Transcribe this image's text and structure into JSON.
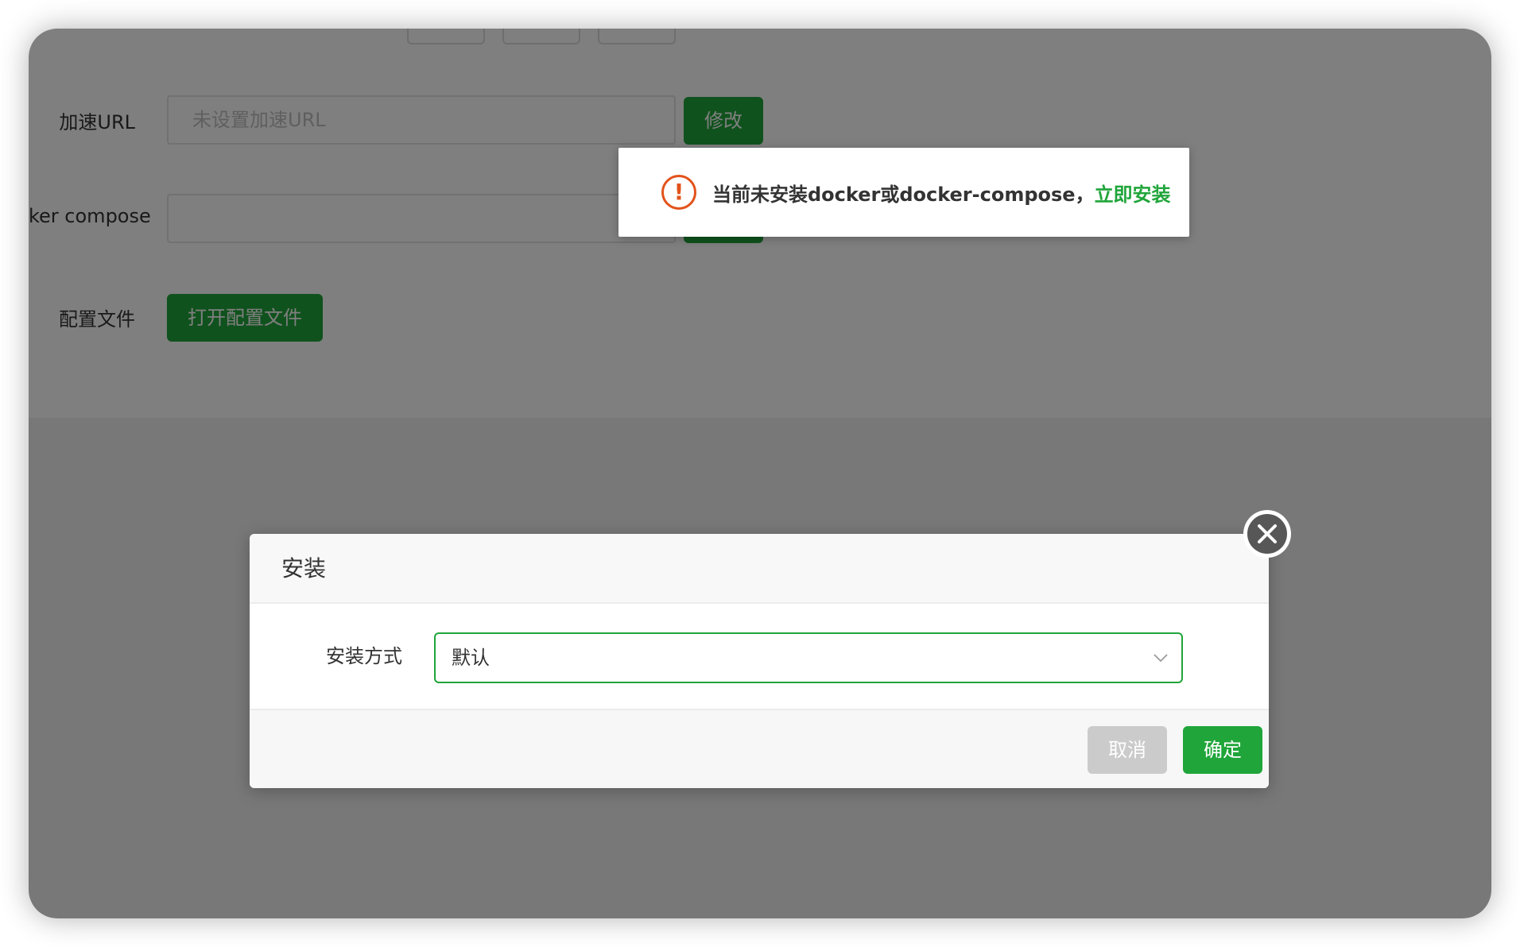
{
  "background_form": {
    "accelerate_url": {
      "label": "加速URL",
      "placeholder": "未设置加速URL",
      "button": "修改"
    },
    "docker_compose": {
      "label": "ker compose",
      "value": ""
    },
    "config_file": {
      "label": "配置文件",
      "button": "打开配置文件"
    }
  },
  "toast": {
    "icon": "warning-circle-icon",
    "message": "当前未安装docker或docker-compose，",
    "link": "立即安装"
  },
  "modal": {
    "title": "安装",
    "field_label": "安装方式",
    "select_value": "默认",
    "cancel_label": "取消",
    "confirm_label": "确定",
    "close_icon": "close-icon"
  },
  "colors": {
    "accent_green": "#20a53a",
    "warning_orange": "#e2531b",
    "overlay": "rgba(0,0,0,0.5)"
  }
}
